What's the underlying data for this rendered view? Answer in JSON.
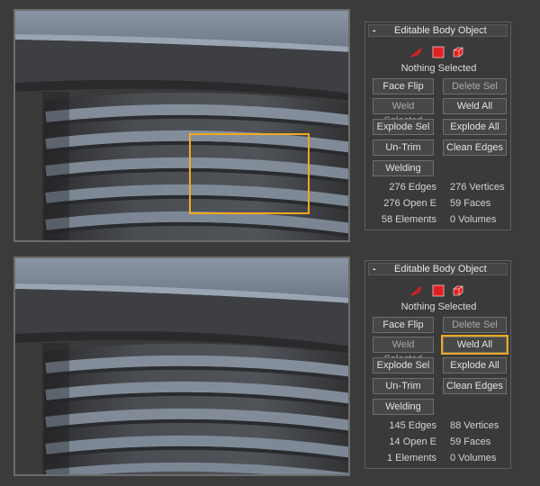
{
  "colors": {
    "accent": "#f0a820",
    "icon_red": "#e41f1f"
  },
  "icons": [
    "select-arrow-icon",
    "face-icon",
    "body-icon"
  ],
  "panels": [
    {
      "header": {
        "minus": "-",
        "title": "Editable Body Object"
      },
      "status": "Nothing Selected",
      "buttons": {
        "face_flip": "Face Flip",
        "delete_sel": "Delete Sel",
        "weld_selected": "Weld Selected",
        "weld_all": "Weld All",
        "explode_sel": "Explode Sel",
        "explode_all": "Explode All",
        "un_trim": "Un-Trim",
        "clean_edges": "Clean Edges",
        "welding": "Welding"
      },
      "stats": {
        "edges": "276 Edges",
        "vertices": "276 Vertices",
        "open_e": "276 Open E",
        "faces": "59 Faces",
        "elements": "58 Elements",
        "volumes": "0 Volumes"
      }
    },
    {
      "header": {
        "minus": "-",
        "title": "Editable Body Object"
      },
      "status": "Nothing Selected",
      "buttons": {
        "face_flip": "Face Flip",
        "delete_sel": "Delete Sel",
        "weld_selected": "Weld Selected",
        "weld_all": "Weld All",
        "explode_sel": "Explode Sel",
        "explode_all": "Explode All",
        "un_trim": "Un-Trim",
        "clean_edges": "Clean Edges",
        "welding": "Welding"
      },
      "stats": {
        "edges": "145 Edges",
        "vertices": "88 Vertices",
        "open_e": "14 Open E",
        "faces": "59 Faces",
        "elements": "1 Elements",
        "volumes": "0 Volumes"
      }
    }
  ]
}
